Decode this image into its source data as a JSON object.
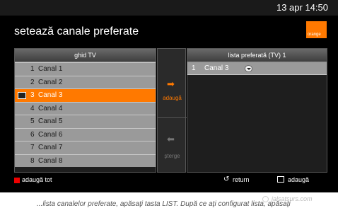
{
  "status": {
    "clock": "13 apr 14:50"
  },
  "header": {
    "title": "setează canale preferate",
    "logo_text": "orange",
    "logo_color": "#ff7900"
  },
  "guide": {
    "header": "ghid TV",
    "channels": [
      {
        "num": "1",
        "name": "Canal 1"
      },
      {
        "num": "2",
        "name": "Canal 2"
      },
      {
        "num": "3",
        "name": "Canal 3",
        "selected": true
      },
      {
        "num": "4",
        "name": "Canal 4"
      },
      {
        "num": "5",
        "name": "Canal 5"
      },
      {
        "num": "6",
        "name": "Canal 6"
      },
      {
        "num": "7",
        "name": "Canal 7"
      },
      {
        "num": "8",
        "name": "Canal 8"
      }
    ]
  },
  "actions": {
    "add": {
      "label": "adaugă",
      "icon": "arrow-right-icon"
    },
    "remove": {
      "label": "şterge",
      "icon": "arrow-left-icon"
    }
  },
  "favorites": {
    "header": "lista preferată (TV) 1",
    "items": [
      {
        "num": "1",
        "name": "Canal 3"
      }
    ]
  },
  "footer": {
    "add_all": "adaugă tot",
    "return": "return",
    "add": "adaugă",
    "red_color": "#e00000"
  },
  "below": {
    "text": "...lista canalelor preferate, apăsaţi tasta LIST. După ce aţi configurat lista, apăsaţi",
    "watermark": "jalsatsurs.com"
  }
}
